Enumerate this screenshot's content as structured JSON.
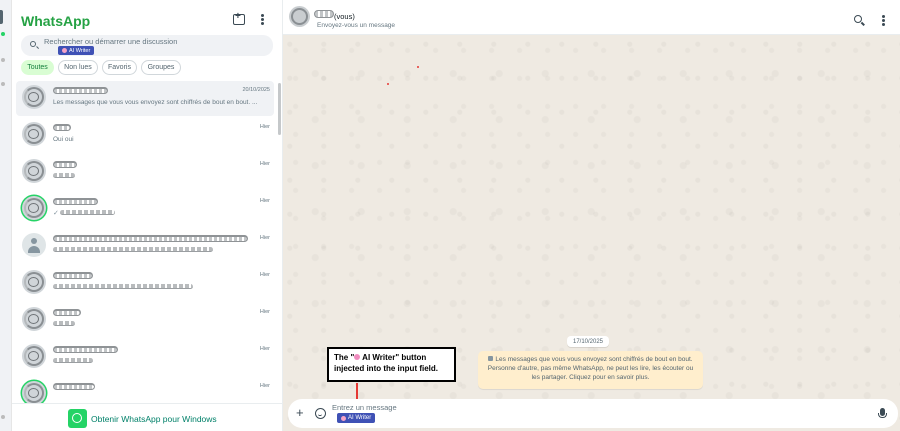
{
  "sidebar": {
    "title": "WhatsApp",
    "search_placeholder": "Rechercher ou démarrer une discussion",
    "ai_writer_label": "AI Writer",
    "filters": [
      "Toutes",
      "Non lues",
      "Favoris",
      "Groupes"
    ],
    "active_filter": "Toutes",
    "chats": [
      {
        "time": "20/10/2025",
        "preview": "Les messages que vous vous envoyez sont chiffrés de bout en bout. ..."
      },
      {
        "time": "Hier",
        "preview": "Oui oui"
      },
      {
        "time": "Hier",
        "preview": ""
      },
      {
        "time": "Hier",
        "preview": ""
      },
      {
        "time": "Hier",
        "preview": ""
      },
      {
        "time": "Hier",
        "preview": ""
      },
      {
        "time": "Hier",
        "preview": ""
      },
      {
        "time": "Hier",
        "preview": ""
      },
      {
        "time": "Hier",
        "preview": ""
      }
    ],
    "promo_text": "Obtenir WhatsApp pour Windows"
  },
  "conversation": {
    "contact_suffix": "(vous)",
    "subtitle": "Envoyez-vous un message",
    "date_pill": "17/10/2025",
    "encryption_notice": "Les messages que vous vous envoyez sont chiffrés de bout en bout. Personne d'autre, pas même WhatsApp, ne peut les lire, les écouter ou les partager. Cliquez pour en savoir plus.",
    "input_placeholder": "Entrez un message",
    "ai_writer_label": "AI Writer"
  },
  "annotation": {
    "line1_prefix": "The \"",
    "line1_label": " AI Writer\" button",
    "line2": "injected into the input field."
  },
  "colors": {
    "brand_green": "#25a244",
    "ai_writer_bg": "#3f51b5",
    "chat_bg": "#efeae2",
    "notice_bg": "#ffeecd",
    "arrow_red": "#e53935"
  },
  "icons": [
    "new-chat-icon",
    "menu-icon",
    "search-icon",
    "brain-icon",
    "lock-icon",
    "plus-icon",
    "emoji-icon",
    "mic-icon",
    "windows-app-icon"
  ]
}
